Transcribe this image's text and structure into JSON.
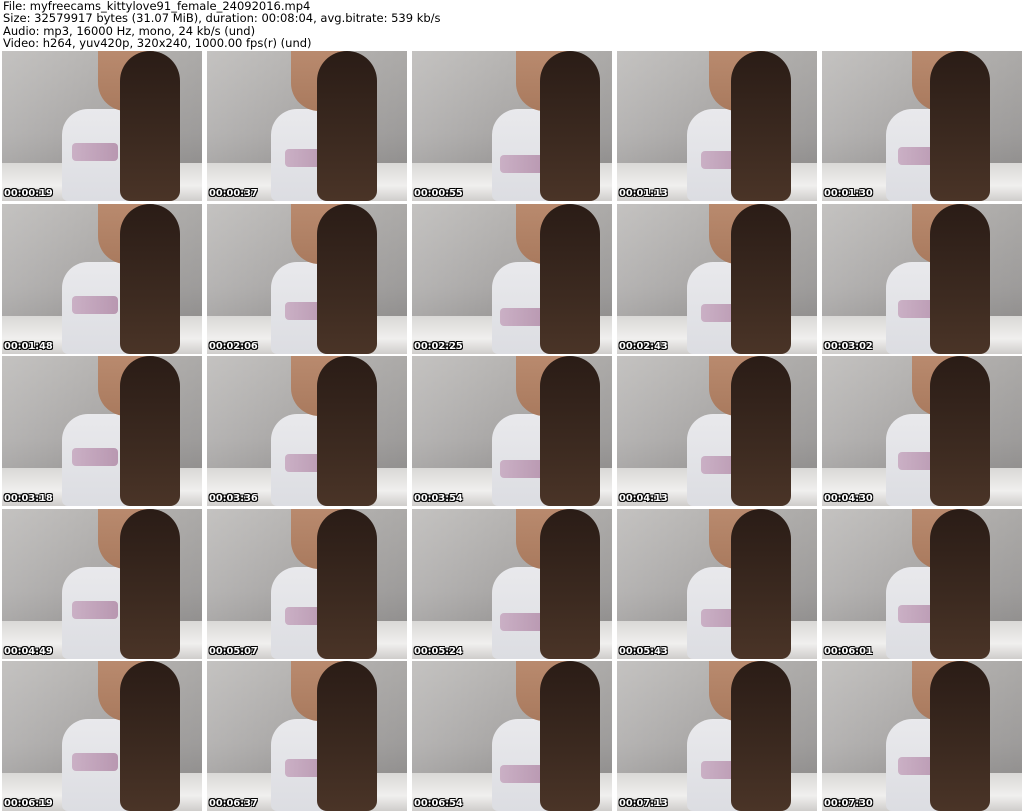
{
  "header": {
    "file": "File: myfreecams_kittylove91_female_24092016.mp4",
    "size": "Size: 32579917 bytes (31.07 MiB), duration: 00:08:04, avg.bitrate: 539 kb/s",
    "audio": "Audio: mp3, 16000 Hz, mono, 24 kb/s (und)",
    "video": "Video: h264, yuv420p, 320x240, 1000.00 fps(r) (und)"
  },
  "thumbnails": [
    {
      "timestamp": "00:00:19"
    },
    {
      "timestamp": "00:00:37"
    },
    {
      "timestamp": "00:00:55"
    },
    {
      "timestamp": "00:01:13"
    },
    {
      "timestamp": "00:01:30"
    },
    {
      "timestamp": "00:01:48"
    },
    {
      "timestamp": "00:02:06"
    },
    {
      "timestamp": "00:02:25"
    },
    {
      "timestamp": "00:02:43"
    },
    {
      "timestamp": "00:03:02"
    },
    {
      "timestamp": "00:03:18"
    },
    {
      "timestamp": "00:03:36"
    },
    {
      "timestamp": "00:03:54"
    },
    {
      "timestamp": "00:04:13"
    },
    {
      "timestamp": "00:04:30"
    },
    {
      "timestamp": "00:04:49"
    },
    {
      "timestamp": "00:05:07"
    },
    {
      "timestamp": "00:05:24"
    },
    {
      "timestamp": "00:05:43"
    },
    {
      "timestamp": "00:06:01"
    },
    {
      "timestamp": "00:06:19"
    },
    {
      "timestamp": "00:06:37"
    },
    {
      "timestamp": "00:06:54"
    },
    {
      "timestamp": "00:07:13"
    },
    {
      "timestamp": "00:07:30"
    }
  ]
}
